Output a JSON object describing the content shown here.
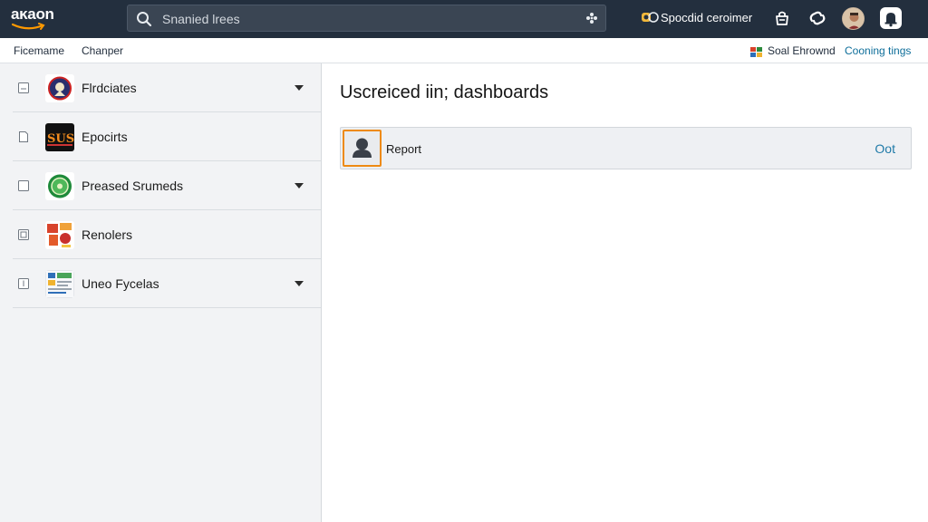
{
  "topbar": {
    "logo_text": "aĸaon",
    "search": {
      "placeholder": "Snanied lrees",
      "command_icon": "gear-cluster-icon"
    },
    "promo_label": "Spocdid ceroimer",
    "icons": [
      "basket-icon",
      "link-icon",
      "avatar",
      "bell-icon"
    ]
  },
  "subnav": {
    "left": [
      "Ficemame",
      "Chanper"
    ],
    "right": [
      "Soal Ehrownd",
      "Cooning tings"
    ]
  },
  "sidebar": {
    "items": [
      {
        "label": "Flrdciates",
        "has_caret": true,
        "thumb": "emblem-icon"
      },
      {
        "label": "Epocirts",
        "has_caret": false,
        "thumb": "title-art-icon"
      },
      {
        "label": "Preased Srumeds",
        "has_caret": true,
        "thumb": "green-badge-icon"
      },
      {
        "label": "Renolers",
        "has_caret": false,
        "thumb": "collage-icon"
      },
      {
        "label": "Uneo Fycelas",
        "has_caret": true,
        "thumb": "report-sheet-icon"
      }
    ]
  },
  "main": {
    "title": "Uscreiced iin; dashboards",
    "card": {
      "label": "Report",
      "action": "Oot",
      "icon": "user-icon"
    }
  },
  "colors": {
    "topbar_bg": "#232f3e",
    "accent_orange": "#ee8a12",
    "link_blue": "#1f7aa8",
    "sidebar_bg": "#f2f3f5"
  }
}
